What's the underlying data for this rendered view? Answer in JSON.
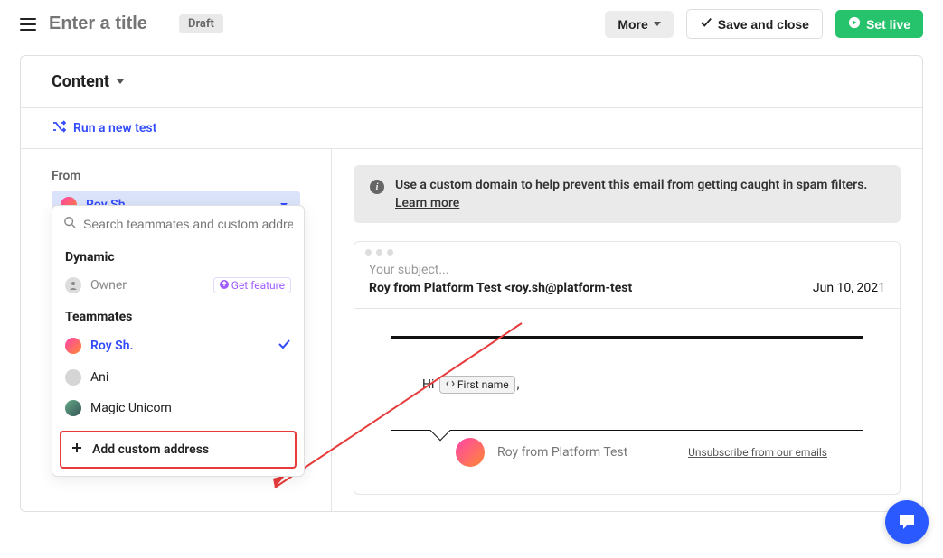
{
  "header": {
    "title_placeholder": "Enter a title",
    "draft_badge": "Draft",
    "more_label": "More",
    "save_label": "Save and close",
    "set_live_label": "Set live"
  },
  "content": {
    "section_title": "Content",
    "run_test_label": "Run a new test",
    "from_label": "From",
    "from_selected": "Roy Sh."
  },
  "dropdown": {
    "search_placeholder": "Search teammates and custom addre",
    "dynamic_label": "Dynamic",
    "owner_label": "Owner",
    "get_feature_label": "Get feature",
    "teammates_label": "Teammates",
    "teammates": [
      {
        "name": "Roy Sh.",
        "selected": true
      },
      {
        "name": "Ani",
        "selected": false
      },
      {
        "name": "Magic Unicorn",
        "selected": false
      }
    ],
    "add_custom_label": "Add custom address"
  },
  "banner": {
    "text": "Use a custom domain to help prevent this email from getting caught in spam filters.",
    "learn_more": "Learn more"
  },
  "email": {
    "subject_placeholder": "Your subject...",
    "from_line": "Roy from Platform Test <roy.sh@platform-test",
    "date": "Jun 10, 2021",
    "greeting_prefix": "Hi",
    "token_label": "First name",
    "greeting_suffix": ",",
    "sender_name": "Roy from Platform Test",
    "unsubscribe_text": "Unsubscribe from our emails"
  }
}
